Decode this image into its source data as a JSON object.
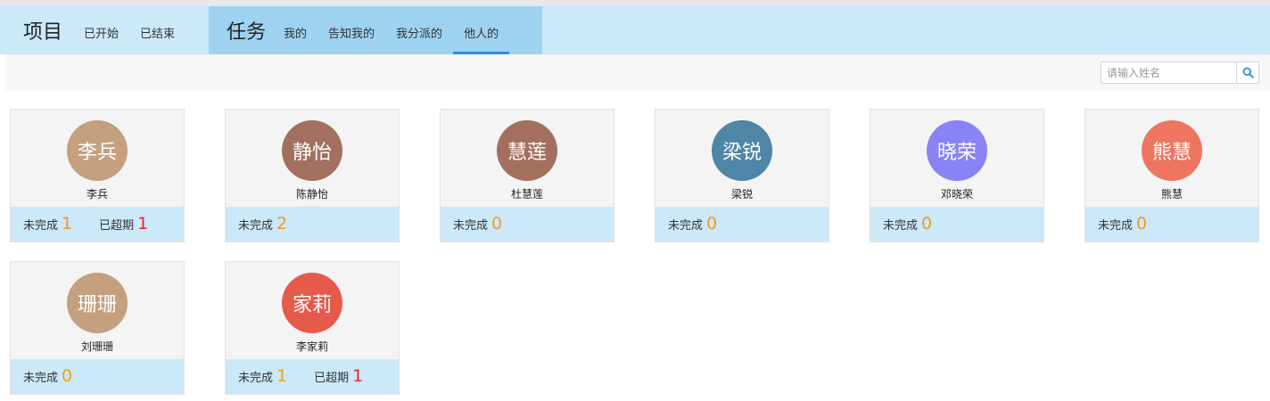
{
  "header": {
    "project": {
      "title": "项目",
      "tabs": [
        {
          "label": "已开始"
        },
        {
          "label": "已结束"
        }
      ]
    },
    "task": {
      "title": "任务",
      "tabs": [
        {
          "label": "我的"
        },
        {
          "label": "告知我的"
        },
        {
          "label": "我分派的"
        },
        {
          "label": "他人的",
          "active": true
        }
      ]
    }
  },
  "search": {
    "placeholder": "请输入姓名",
    "icon": "search-icon"
  },
  "labels": {
    "incomplete": "未完成",
    "overdue": "已超期"
  },
  "colors": {
    "accent": "#2b8fe0",
    "incomplete_number": "#f39a1e",
    "overdue_number": "#e8262a"
  },
  "people": [
    {
      "avatar_text": "李兵",
      "name": "李兵",
      "avatar_color": "#c4a07f",
      "incomplete": "1",
      "overdue": "1"
    },
    {
      "avatar_text": "静怡",
      "name": "陈静怡",
      "avatar_color": "#a3705f",
      "incomplete": "2"
    },
    {
      "avatar_text": "慧莲",
      "name": "杜慧莲",
      "avatar_color": "#a3705f",
      "incomplete": "0"
    },
    {
      "avatar_text": "梁锐",
      "name": "梁锐",
      "avatar_color": "#4f85a6",
      "incomplete": "0"
    },
    {
      "avatar_text": "晓荣",
      "name": "邓晓荣",
      "avatar_color": "#8a83f5",
      "incomplete": "0"
    },
    {
      "avatar_text": "熊慧",
      "name": "熊慧",
      "avatar_color": "#ee7560",
      "incomplete": "0"
    },
    {
      "avatar_text": "珊珊",
      "name": "刘珊珊",
      "avatar_color": "#c4a07f",
      "incomplete": "0"
    },
    {
      "avatar_text": "家莉",
      "name": "李家莉",
      "avatar_color": "#e65a4b",
      "incomplete": "1",
      "overdue": "1"
    }
  ]
}
